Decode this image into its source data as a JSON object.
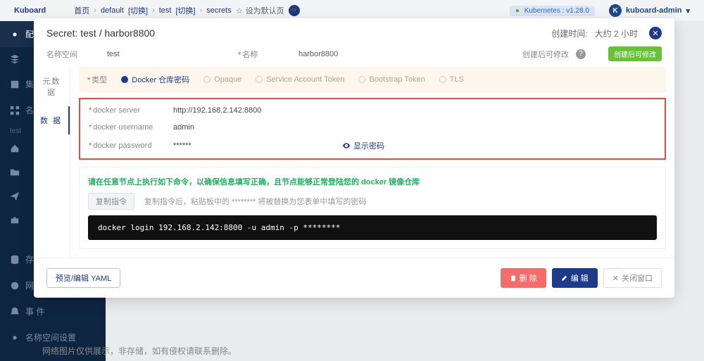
{
  "header": {
    "brand": "Kuboard",
    "breadcrumb": {
      "home": "首页",
      "ns": "default",
      "ns_action": "[切换]",
      "sub": "test",
      "sub_action": "[切换]",
      "leaf": "secrets",
      "star": "设为默认页"
    },
    "version_status": "Kubernetes",
    "version": "v1.28.0",
    "user": "kuboard-admin",
    "avatar_letter": "K"
  },
  "sidebar": {
    "label_top": "test",
    "items": [
      {
        "icon": "gear",
        "text": "配"
      },
      {
        "icon": "layers",
        "text": ""
      },
      {
        "icon": "box",
        "text": "集"
      },
      {
        "icon": "grid",
        "text": "名"
      },
      {
        "icon": "home",
        "text": ""
      },
      {
        "icon": "folder",
        "text": ""
      },
      {
        "icon": "send",
        "text": ""
      },
      {
        "icon": "briefcase",
        "text": ""
      }
    ],
    "storage": "存 储",
    "netpolicy": "网络策略",
    "events": "事 件",
    "ns_settings": "名称空间设置"
  },
  "modal": {
    "title": "Secret: test / harbor8800",
    "created_label": "创建时间:",
    "created_value": "大约 2 小时",
    "namespace_label": "名称空间",
    "namespace_value": "test",
    "name_label": "名称",
    "name_value": "harbor8800",
    "editable_label": "创建后可修改",
    "editable_badge": "创建后可修改",
    "tab_meta": "元数据",
    "tab_data": "数 据",
    "type_label": "类型",
    "type_options": [
      "Docker 仓库密码",
      "Opaque",
      "Service Account Token",
      "Bootstrap Token",
      "TLS"
    ],
    "creds": {
      "server_label": "docker server",
      "server_value": "http://192.168.2.142:8800",
      "user_label": "docker username",
      "user_value": "admin",
      "pw_label": "docker password",
      "pw_value": "******",
      "show_pw": "显示密码"
    },
    "note": {
      "instruction": "请在任意节点上执行如下命令，以确保信息填写正确，且节点能够正常登陆您的 docker 镜像仓库",
      "copy_btn": "复制指令",
      "copy_hint": "复制指令后，粘贴板中的 ******** 将被替换为您表单中填写的密码",
      "command": "docker login 192.168.2.142:8800 -u admin -p ********"
    },
    "footer": {
      "yaml": "预览/编辑 YAML",
      "delete": "删 除",
      "edit": "编 辑",
      "close": "关闭窗口"
    }
  },
  "page_footer": "网络图片仅供展示，非存储，如有侵权请联系删除。"
}
